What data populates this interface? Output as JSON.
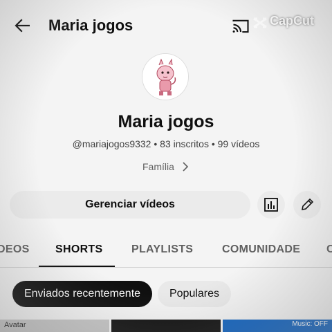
{
  "header": {
    "title": "Maria jogos",
    "watermark": "CapCut"
  },
  "channel": {
    "name": "Maria jogos",
    "meta": "@mariajogos9332 • 83 inscritos • 99 vídeos",
    "category": "Família"
  },
  "actions": {
    "manage_label": "Gerenciar vídeos"
  },
  "tabs": [
    {
      "label": "DEOS"
    },
    {
      "label": "SHORTS",
      "active": true
    },
    {
      "label": "PLAYLISTS"
    },
    {
      "label": "COMUNIDADE"
    },
    {
      "label": "C"
    }
  ],
  "filters": [
    {
      "label": "Enviados recentemente",
      "active": true
    },
    {
      "label": "Populares",
      "active": false
    }
  ],
  "thumbnails": {
    "first_label": "Avatar",
    "third_label": "Music: OFF"
  },
  "icons": {
    "back": "arrow-left-icon",
    "cast": "cast-icon",
    "analytics": "bar-chart-icon",
    "edit": "pencil-icon",
    "category_chevron": "chevron-right-icon"
  },
  "colors": {
    "background": "#f4f4f4",
    "active_chip": "#0f0f0f",
    "button_bg": "#ebebeb",
    "thumb_blue": "#1565c0"
  }
}
